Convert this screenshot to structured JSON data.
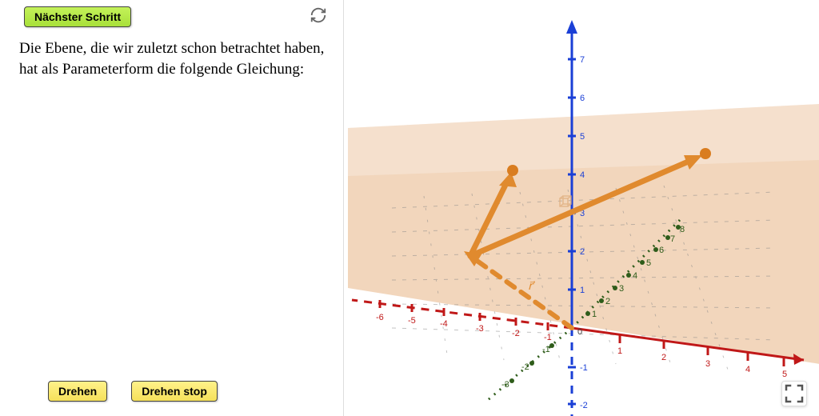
{
  "buttons": {
    "next_step": "Nächster Schritt",
    "rotate": "Drehen",
    "rotate_stop": "Drehen stop"
  },
  "description": "Die Ebene, die wir zuletzt schon betrachtet haben, hat als Parameterform die folgende Gleichung:",
  "vector_label": "r⃗",
  "axes": {
    "z_ticks": [
      "-2",
      "-1",
      "1",
      "2",
      "3",
      "4",
      "5",
      "6",
      "7"
    ],
    "x_ticks_neg": [
      "-6",
      "-5",
      "-4",
      "-3",
      "-2",
      "-1"
    ],
    "x_ticks_pos": [
      "1",
      "2",
      "3",
      "4",
      "5"
    ],
    "y_ticks_neg": [
      "-3",
      "-2",
      "-1"
    ],
    "y_ticks_pos": [
      "1",
      "2",
      "3",
      "4",
      "5",
      "6",
      "7",
      "8"
    ]
  },
  "origin_label": "0",
  "colors": {
    "plane": "#e3a56b",
    "vector": "#e08a2e",
    "x_axis": "#c01818",
    "y_axis": "#2e5c1a",
    "z_axis": "#1a3fd6"
  }
}
